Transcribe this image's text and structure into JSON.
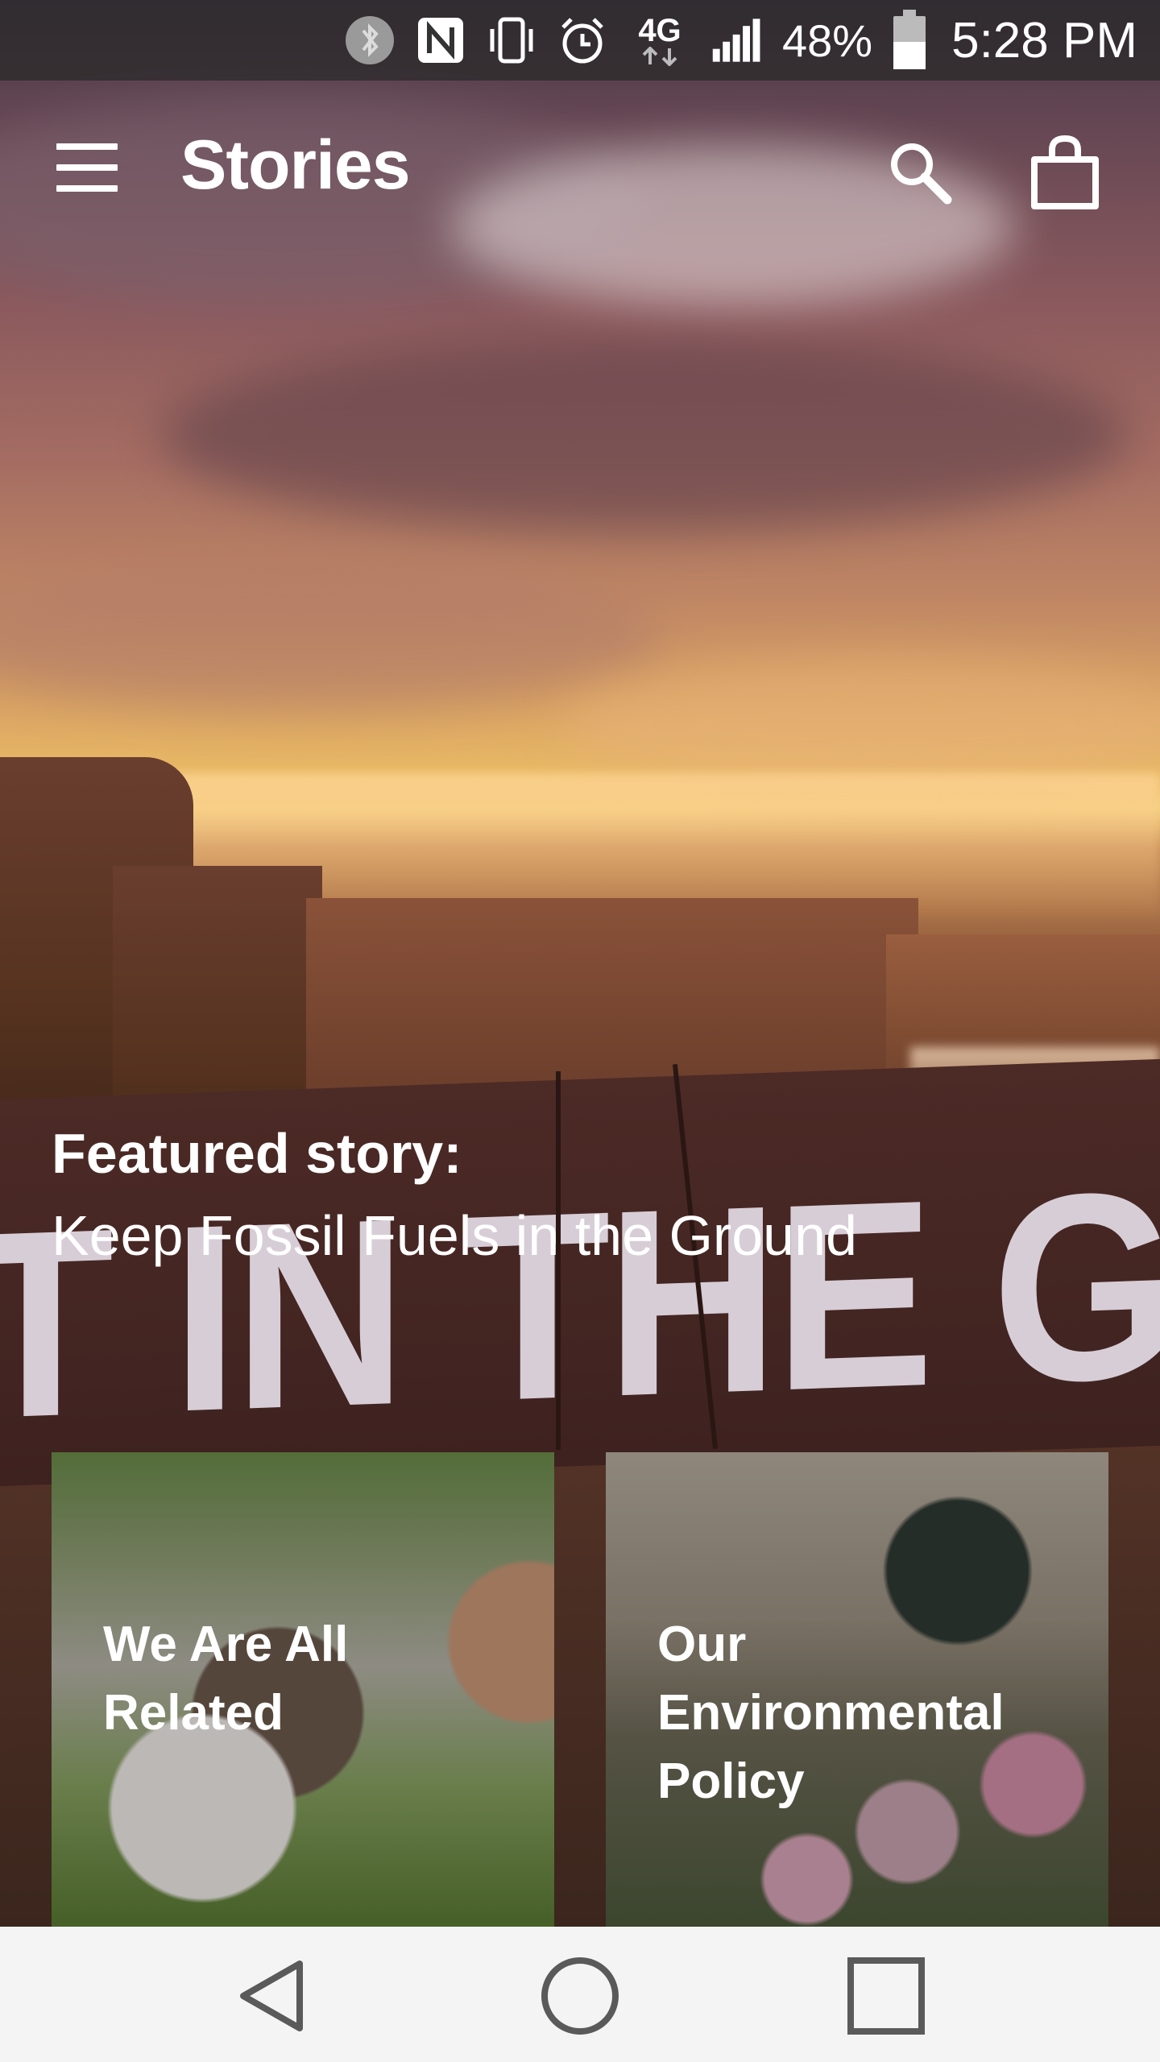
{
  "status_bar": {
    "icons": [
      "bluetooth-icon",
      "nfc-icon",
      "vibrate-icon",
      "alarm-icon",
      "lte-icon",
      "signal-icon",
      "battery-icon"
    ],
    "network": "4G",
    "battery_percent": "48%",
    "time": "5:28 PM"
  },
  "app_bar": {
    "title": "Stories",
    "menu_icon": "hamburger-menu-icon",
    "search_icon": "search-icon",
    "cart_icon": "shopping-bag-icon"
  },
  "featured": {
    "label": "Featured story:",
    "title": "Keep Fossil Fuels in the Ground",
    "banner_text": "T IN THE G"
  },
  "cards": [
    {
      "title": "We Are All Related"
    },
    {
      "title": "Our Environmental Policy"
    }
  ],
  "nav_bar": {
    "back_icon": "back-triangle-icon",
    "home_icon": "home-circle-icon",
    "recents_icon": "recents-square-icon"
  }
}
